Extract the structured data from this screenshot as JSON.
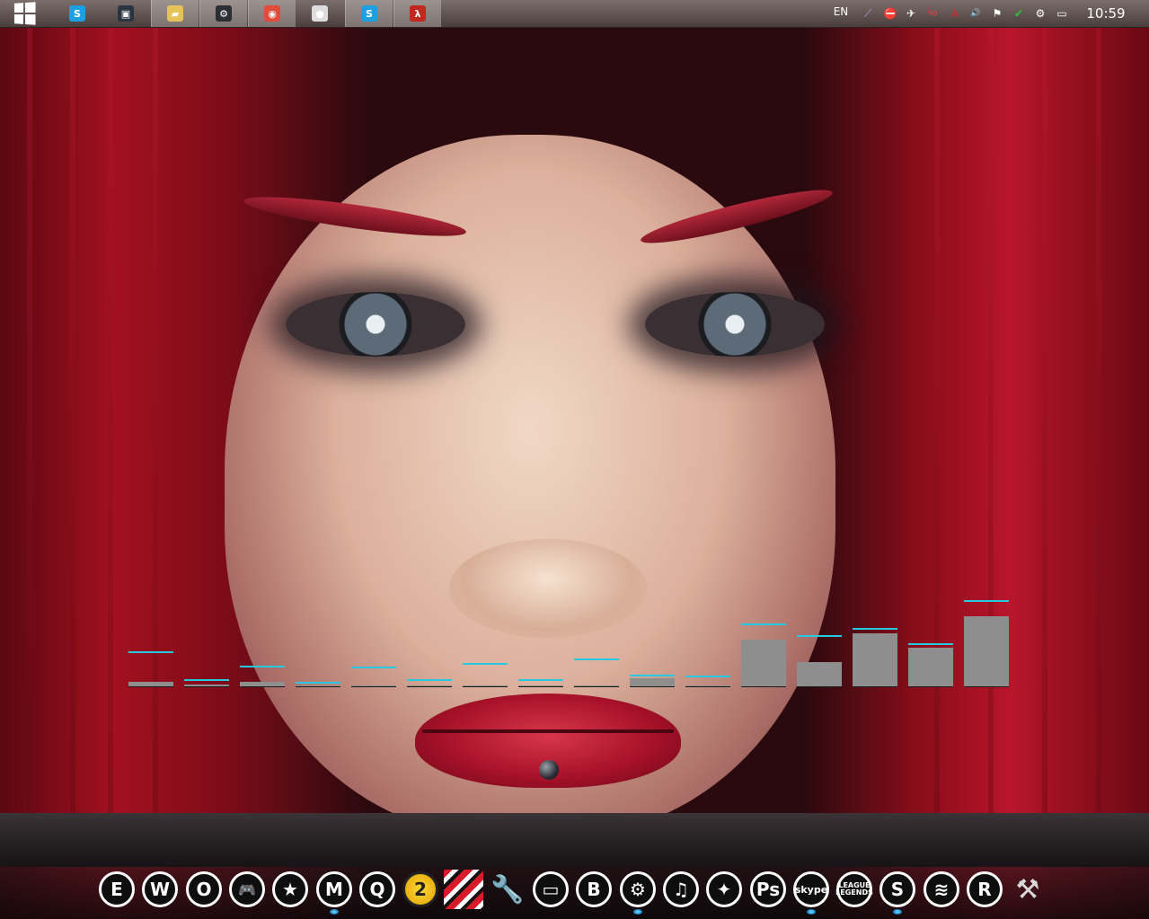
{
  "taskbar": {
    "start_label": "",
    "windows": [
      {
        "name": "skype",
        "icon": "skype-icon",
        "color": "#1ea0e0",
        "glyph": "S",
        "active": false
      },
      {
        "name": "console",
        "icon": "console-window-icon",
        "color": "#2a3440",
        "glyph": "▣",
        "active": false
      },
      {
        "name": "file-explorer",
        "icon": "folder-icon",
        "color": "#e6c35a",
        "glyph": "▰",
        "active": true
      },
      {
        "name": "steam",
        "icon": "steam-icon",
        "color": "#2b2f35",
        "glyph": "⚙",
        "active": true
      },
      {
        "name": "chrome",
        "icon": "chrome-icon",
        "color": "#e04b3a",
        "glyph": "◉",
        "active": true
      },
      {
        "name": "media-player",
        "icon": "ball-icon",
        "color": "#dcdcdc",
        "glyph": "●",
        "active": false
      },
      {
        "name": "skype-2",
        "icon": "skype-icon",
        "color": "#1ea0e0",
        "glyph": "S",
        "active": true
      },
      {
        "name": "half-life",
        "icon": "half-life-icon",
        "color": "#c0281f",
        "glyph": "λ",
        "active": true
      }
    ],
    "language": "EN",
    "tray": [
      {
        "icon": "feather-icon",
        "glyph": "⟋",
        "color": "#c29bf5"
      },
      {
        "icon": "stop-icon",
        "glyph": "⛔",
        "color": "#e23b3b"
      },
      {
        "icon": "airplane-icon",
        "glyph": "✈",
        "color": "#ffffff"
      },
      {
        "icon": "record-icon",
        "glyph": "чо",
        "color": "#ff3b3b"
      },
      {
        "icon": "adobe-icon",
        "glyph": "A",
        "color": "#e0242a"
      },
      {
        "icon": "volume-icon",
        "glyph": "🔊",
        "color": "#ffffff"
      },
      {
        "icon": "flag-icon",
        "glyph": "⚑",
        "color": "#ffffff"
      },
      {
        "icon": "check-icon",
        "glyph": "✔",
        "color": "#2ec23a"
      },
      {
        "icon": "steam-tray-icon",
        "glyph": "⚙",
        "color": "#ffffff"
      },
      {
        "icon": "network-icon",
        "glyph": "▭",
        "color": "#ffffff"
      }
    ],
    "clock": "10:59"
  },
  "visualizer": {
    "bars": [
      {
        "level": 0.07,
        "peak": 0.46
      },
      {
        "level": 0.03,
        "peak": 0.07
      },
      {
        "level": 0.06,
        "peak": 0.25
      },
      {
        "level": 0.01,
        "peak": 0.03
      },
      {
        "level": 0.01,
        "peak": 0.24
      },
      {
        "level": 0.01,
        "peak": 0.06
      },
      {
        "level": 0.01,
        "peak": 0.29
      },
      {
        "level": 0.01,
        "peak": 0.06
      },
      {
        "level": 0.01,
        "peak": 0.36
      },
      {
        "level": 0.12,
        "peak": 0.13
      },
      {
        "level": 0.01,
        "peak": 0.11
      },
      {
        "level": 0.67,
        "peak": 0.86
      },
      {
        "level": 0.34,
        "peak": 0.69
      },
      {
        "level": 0.76,
        "peak": 0.79
      },
      {
        "level": 0.55,
        "peak": 0.58
      },
      {
        "level": 1.0,
        "peak": 1.19
      }
    ],
    "bar_color": "#8e8e8e",
    "peak_color": "#26c9e0"
  },
  "dock": {
    "items": [
      {
        "icon": "e-icon",
        "label": "E",
        "style": "circle",
        "running": false
      },
      {
        "icon": "w-icon",
        "label": "W",
        "style": "circle",
        "running": false
      },
      {
        "icon": "o-icon",
        "label": "O",
        "style": "circle",
        "running": false
      },
      {
        "icon": "gamepad-icon",
        "label": "🎮",
        "style": "circle",
        "running": false
      },
      {
        "icon": "star-icon",
        "label": "★",
        "style": "circle",
        "running": false
      },
      {
        "icon": "m-icon",
        "label": "M",
        "style": "circle",
        "running": true
      },
      {
        "icon": "q-icon",
        "label": "Q",
        "style": "circle",
        "running": false
      },
      {
        "icon": "borderlands2-icon",
        "label": "2",
        "style": "yellow",
        "running": false
      },
      {
        "icon": "stripes-icon",
        "label": "",
        "style": "stripes",
        "running": false
      },
      {
        "icon": "wrench-icon",
        "label": "🔧",
        "style": "plain",
        "running": false
      },
      {
        "icon": "monitor-icon",
        "label": "▭",
        "style": "circle",
        "running": false
      },
      {
        "icon": "b-icon",
        "label": "B",
        "style": "circle",
        "running": false
      },
      {
        "icon": "steam-dock-icon",
        "label": "⚙",
        "style": "circle",
        "running": true
      },
      {
        "icon": "audio-icon",
        "label": "♫",
        "style": "circle",
        "running": false
      },
      {
        "icon": "counter-strike-icon",
        "label": "✦",
        "style": "circle",
        "running": false
      },
      {
        "icon": "photoshop-icon",
        "label": "Ps",
        "style": "circle",
        "running": false
      },
      {
        "icon": "skype-dock-icon",
        "label": "skype",
        "style": "circle-mid",
        "running": true
      },
      {
        "icon": "league-of-legends-icon",
        "label": "LEAGUE LEGENDS",
        "style": "circle-small",
        "running": false
      },
      {
        "icon": "s-icon",
        "label": "S",
        "style": "circle",
        "running": true
      },
      {
        "icon": "swoosh-icon",
        "label": "≋",
        "style": "circle",
        "running": false
      },
      {
        "icon": "r-icon",
        "label": "R",
        "style": "circle",
        "running": false
      },
      {
        "icon": "hammer-icon",
        "label": "⚒",
        "style": "plain",
        "running": false
      }
    ]
  }
}
